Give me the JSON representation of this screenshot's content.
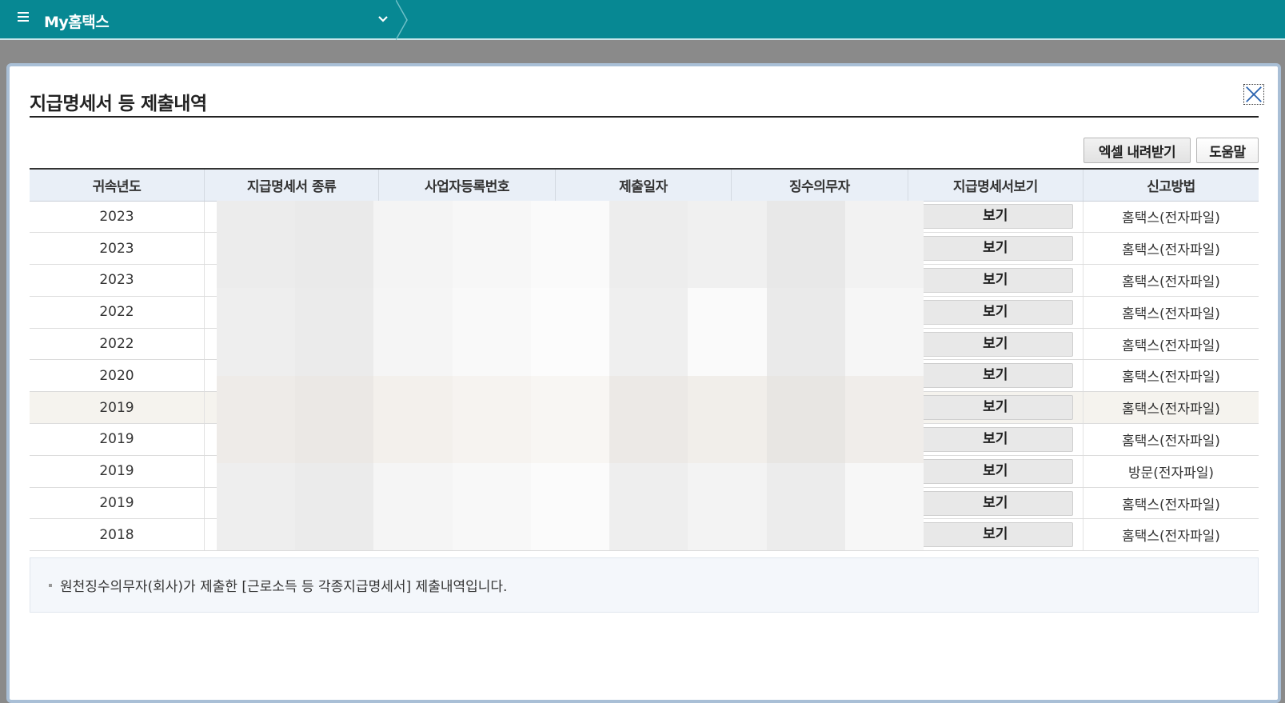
{
  "topbar": {
    "app_title": "My홈택스",
    "icons": [
      "menu-icon",
      "chevron-down-icon"
    ]
  },
  "modal": {
    "title": "지급명세서 등 제출내역",
    "excel_button": "엑셀 내려받기",
    "help_button": "도움말",
    "close_icon": "close-icon",
    "table": {
      "headers": [
        "귀속년도",
        "지급명세서 종류",
        "사업자등록번호",
        "제출일자",
        "징수의무자",
        "지급명세서보기",
        "신고방법"
      ],
      "rows": [
        {
          "year": "2023",
          "view": "보기",
          "method": "홈택스(전자파일)"
        },
        {
          "year": "2023",
          "view": "보기",
          "method": "홈택스(전자파일)"
        },
        {
          "year": "2023",
          "view": "보기",
          "method": "홈택스(전자파일)"
        },
        {
          "year": "2022",
          "view": "보기",
          "method": "홈택스(전자파일)"
        },
        {
          "year": "2022",
          "view": "보기",
          "method": "홈택스(전자파일)"
        },
        {
          "year": "2020",
          "view": "보기",
          "method": "홈택스(전자파일)"
        },
        {
          "year": "2019",
          "view": "보기",
          "method": "홈택스(전자파일)"
        },
        {
          "year": "2019",
          "view": "보기",
          "method": "홈택스(전자파일)"
        },
        {
          "year": "2019",
          "view": "보기",
          "method": "방문(전자파일)"
        },
        {
          "year": "2019",
          "view": "보기",
          "method": "홈택스(전자파일)"
        },
        {
          "year": "2018",
          "view": "보기",
          "method": "홈택스(전자파일)"
        }
      ]
    },
    "note": "원천징수의무자(회사)가 제출한 [근로소득 등 각종지급명세서] 제출내역입니다."
  },
  "colors": {
    "topbar": "#078893",
    "header_bg": "#e9eff7",
    "highlight_row": "#f5f3ee"
  }
}
